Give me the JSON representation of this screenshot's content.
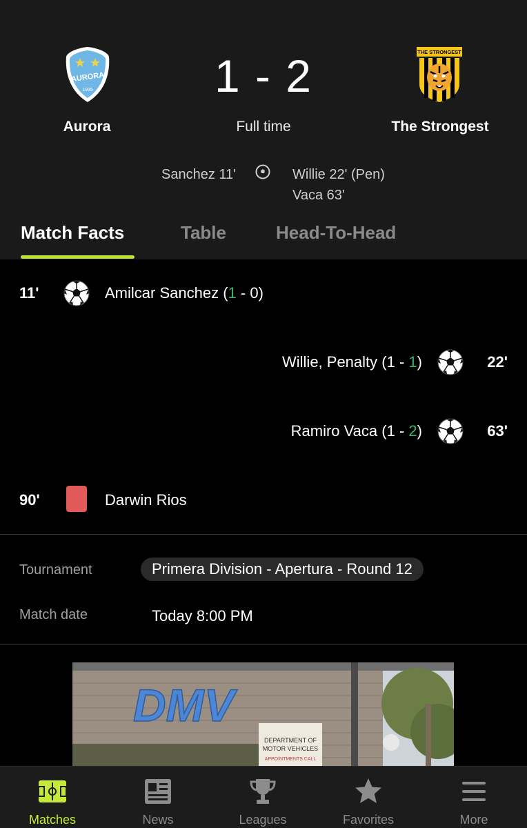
{
  "match": {
    "home_team": "Aurora",
    "away_team": "The Strongest",
    "score": "1 - 2",
    "status": "Full time",
    "home_crest_text": "AURORA",
    "home_crest_year": "1935",
    "away_crest_text": "THE STRONGEST",
    "home_scorers": [
      "Sanchez  11'"
    ],
    "away_scorers": [
      "Willie  22' (Pen)",
      "Vaca  63'"
    ]
  },
  "tabs": [
    "Match Facts",
    "Table",
    "Head-To-Head"
  ],
  "events": [
    {
      "minute": "11'",
      "player": "Amilcar Sanchez",
      "score_pre": " (",
      "score_home": "1",
      "score_sep": " - ",
      "score_away": "0",
      "score_post": ")"
    },
    {
      "minute": "22'",
      "player": "Willie, Penalty",
      "score_pre": " (",
      "score_home": "1",
      "score_sep": " - ",
      "score_away": "1",
      "score_post": ")"
    },
    {
      "minute": "63'",
      "player": "Ramiro Vaca",
      "score_pre": " (",
      "score_home": "1",
      "score_sep": " - ",
      "score_away": "2",
      "score_post": ")"
    },
    {
      "minute": "90'",
      "player": "Darwin Rios"
    }
  ],
  "info": {
    "tournament_label": "Tournament",
    "tournament_value": "Primera Division - Apertura - Round 12",
    "date_label": "Match date",
    "date_value": "Today 8:00 PM"
  },
  "news_image": {
    "sign_text": "DMV",
    "sub_sign_line1": "DEPARTMENT OF",
    "sub_sign_line2": "MOTOR VEHICLES",
    "notice": "APPOINTMENTS CALL"
  },
  "nav": [
    {
      "label": "Matches",
      "icon": "pitch-icon",
      "active": true
    },
    {
      "label": "News",
      "icon": "newspaper-icon",
      "active": false
    },
    {
      "label": "Leagues",
      "icon": "trophy-icon",
      "active": false
    },
    {
      "label": "Favorites",
      "icon": "star-icon",
      "active": false
    },
    {
      "label": "More",
      "icon": "menu-icon",
      "active": false
    }
  ],
  "colors": {
    "accent": "#c4ea37",
    "goal_highlight": "#3bb56c",
    "red_card": "#e05a59",
    "header_bg": "#1a1a1a"
  }
}
